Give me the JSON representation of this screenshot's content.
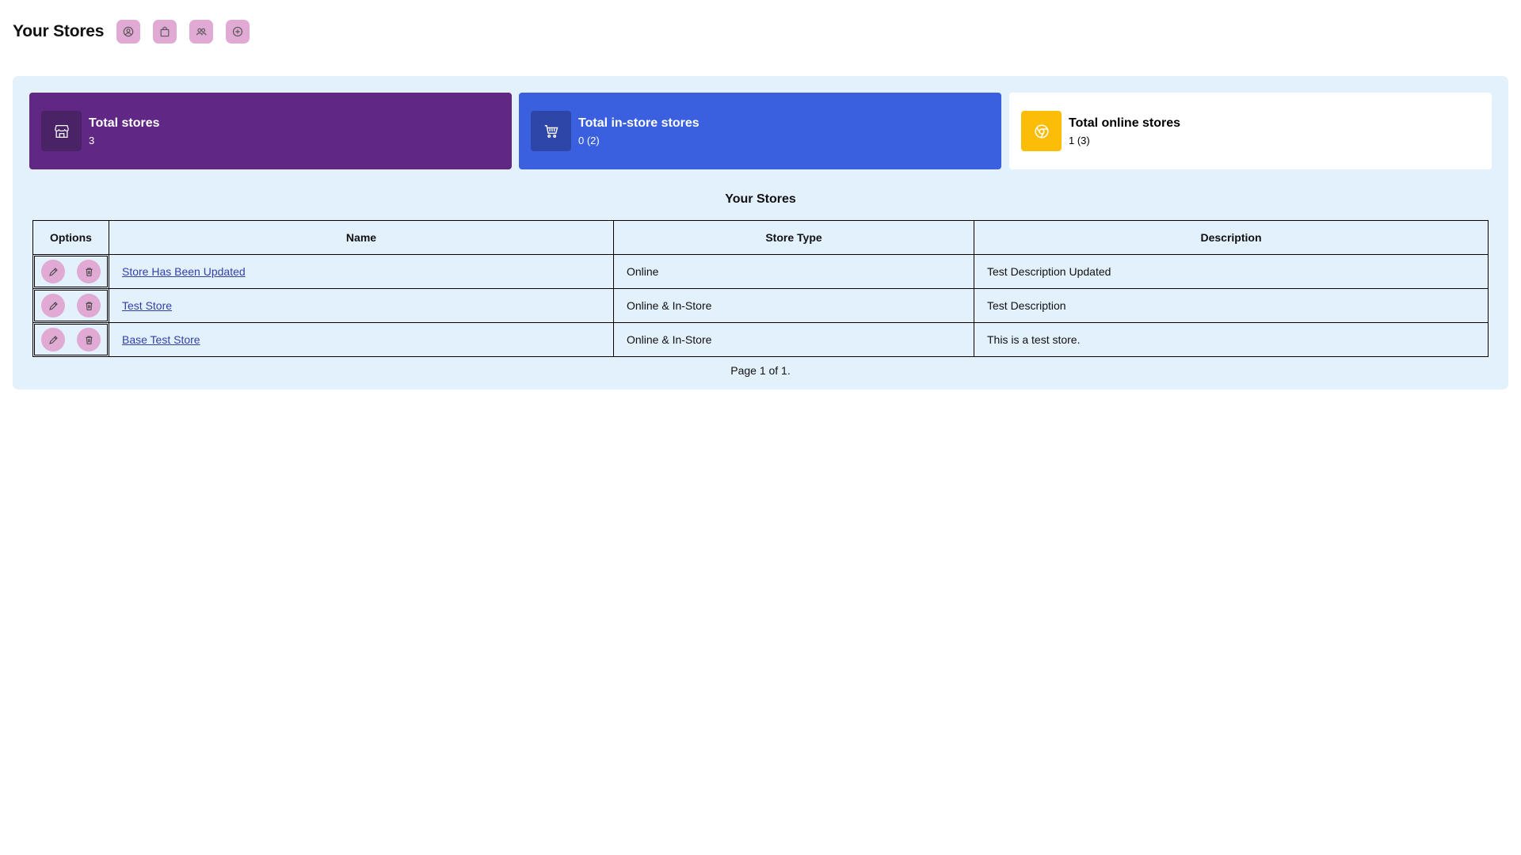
{
  "header": {
    "title": "Your Stores",
    "icons": [
      "account-icon",
      "bag-icon",
      "users-icon",
      "add-circle-icon"
    ]
  },
  "stats": [
    {
      "title": "Total stores",
      "value": "3",
      "icon": "storefront-icon",
      "color": "#612784"
    },
    {
      "title": "Total in-store stores",
      "value": "0 (2)",
      "icon": "cart-icon",
      "color": "#3a60e0"
    },
    {
      "title": "Total online stores",
      "value": "1 (3)",
      "icon": "chrome-icon",
      "color": "#fbbd08"
    }
  ],
  "table": {
    "title": "Your Stores",
    "columns": [
      "Options",
      "Name",
      "Store Type",
      "Description"
    ],
    "rows": [
      {
        "name": "Store Has Been Updated",
        "type": "Online",
        "description": "Test Description Updated"
      },
      {
        "name": "Test Store",
        "type": "Online & In-Store",
        "description": "Test Description"
      },
      {
        "name": "Base Test Store",
        "type": "Online & In-Store",
        "description": "This is a test store."
      }
    ],
    "pagination": "Page 1 of 1."
  },
  "colors": {
    "panel_bg": "#e3f1fc",
    "button_bg": "#e0aad4",
    "link": "#3340a8"
  }
}
